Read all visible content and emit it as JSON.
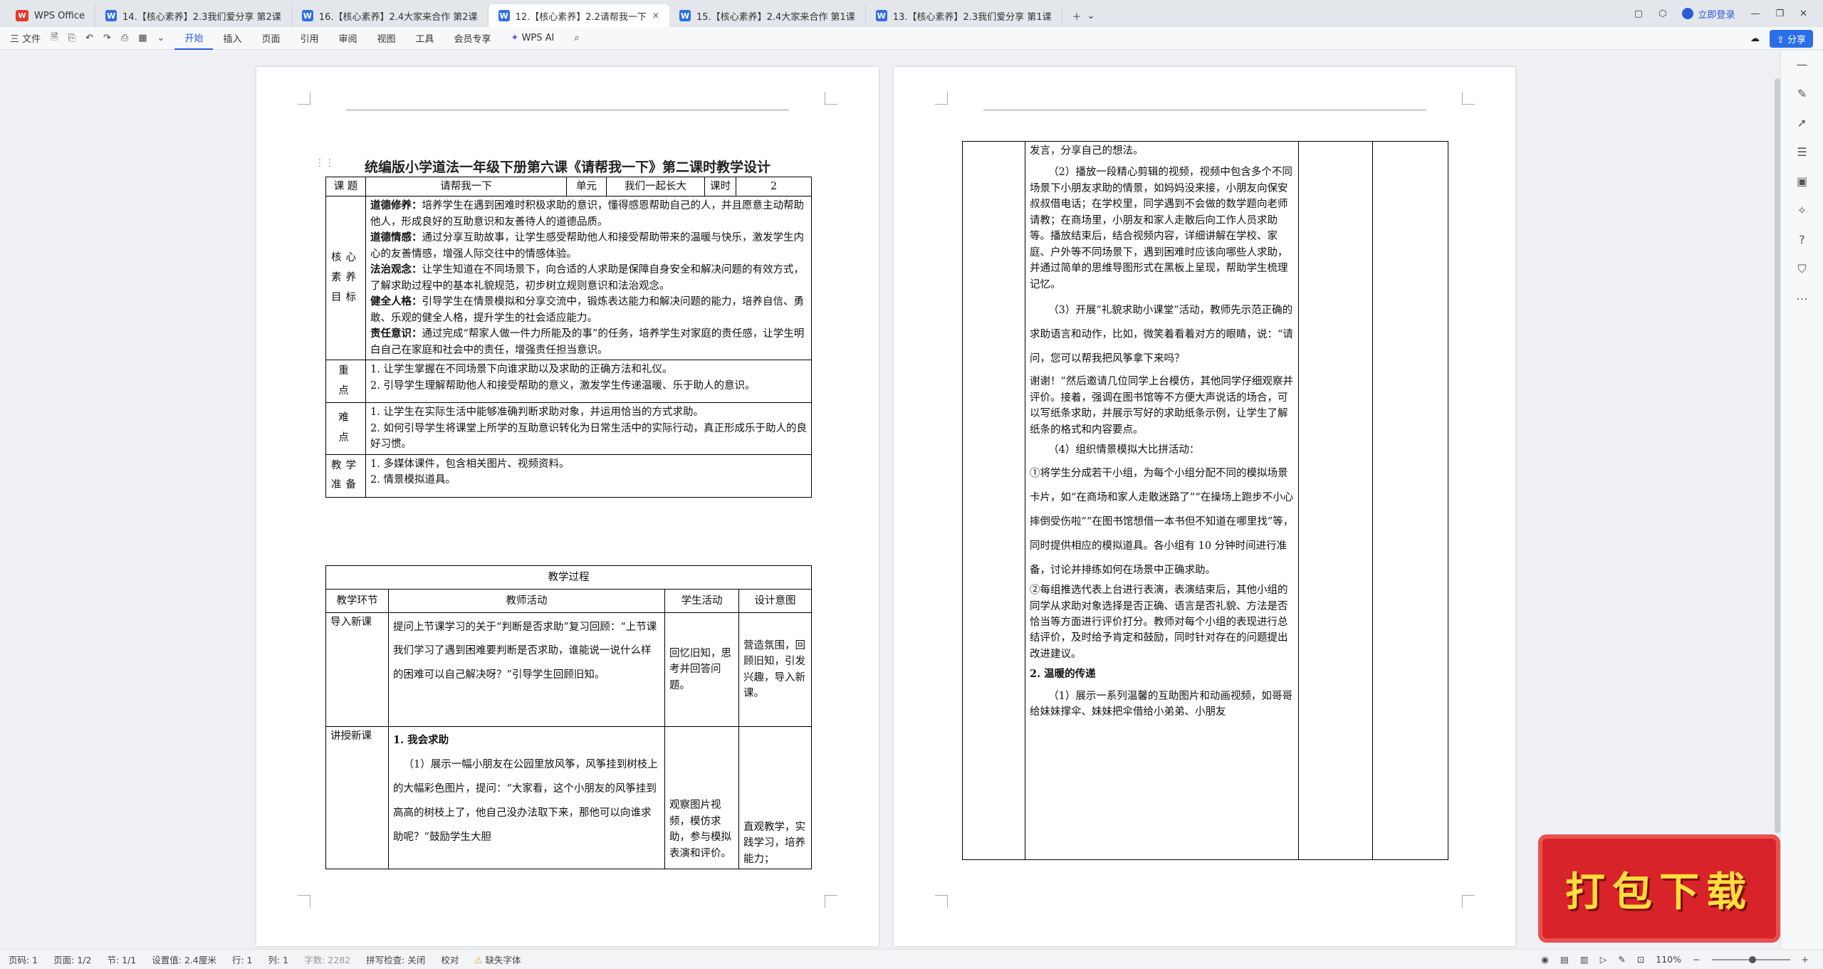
{
  "tabs": [
    {
      "label": "WPS Office",
      "icon": "wps-logo-icon"
    },
    {
      "label": "14.【核心素养】2.3我们爱分享 第2课",
      "icon": "word-doc-icon"
    },
    {
      "label": "16.【核心素养】2.4大家来合作 第2课",
      "icon": "word-doc-icon"
    },
    {
      "label": "12.【核心素养】2.2请帮我一下",
      "icon": "word-doc-icon",
      "active": true
    },
    {
      "label": "15.【核心素养】2.4大家来合作 第1课",
      "icon": "word-doc-icon"
    },
    {
      "label": "13.【核心素养】2.3我们爱分享 第1课",
      "icon": "word-doc-icon"
    }
  ],
  "login_label": "立即登录",
  "toolbar": {
    "file_label": "三 文件",
    "menus": [
      "开始",
      "插入",
      "页面",
      "引用",
      "审阅",
      "视图",
      "工具",
      "会员专享"
    ],
    "ai_label": "WPS AI",
    "share_label": "分享"
  },
  "doc": {
    "title": "统编版小学道法一年级下册第六课《请帮我一下》第二课时教学设计",
    "info": {
      "k_topic": "课 题",
      "v_topic": "请帮我一下",
      "k_unit": "单元",
      "v_unit": "我们一起长大",
      "k_period": "课时",
      "v_period": "2"
    },
    "core_label": "核心素养目标",
    "core": [
      {
        "lead": "道德修养：",
        "text": "培养学生在遇到困难时积极求助的意识，懂得感恩帮助自己的人，并且愿意主动帮助他人，形成良好的互助意识和友善待人的道德品质。"
      },
      {
        "lead": "道德情感：",
        "text": "通过分享互助故事，让学生感受帮助他人和接受帮助带来的温暖与快乐，激发学生内心的友善情感，增强人际交往中的情感体验。"
      },
      {
        "lead": "法治观念：",
        "text": "让学生知道在不同场景下，向合适的人求助是保障自身安全和解决问题的有效方式，了解求助过程中的基本礼貌规范，初步树立规则意识和法治观念。"
      },
      {
        "lead": "健全人格：",
        "text": "引导学生在情景模拟和分享交流中，锻炼表达能力和解决问题的能力，培养自信、勇敢、乐观的健全人格，提升学生的社会适应能力。"
      },
      {
        "lead": "责任意识：",
        "text": "通过完成“帮家人做一件力所能及的事”的任务，培养学生对家庭的责任感，让学生明白自己在家庭和社会中的责任，增强责任担当意识。"
      }
    ],
    "key_label": "重 点",
    "key_points": [
      "1. 让学生掌握在不同场景下向谁求助以及求助的正确方法和礼仪。",
      "2. 引导学生理解帮助他人和接受帮助的意义，激发学生传递温暖、乐于助人的意识。"
    ],
    "diff_label": "难 点",
    "diff_points": [
      "1. 让学生在实际生活中能够准确判断求助对象，并运用恰当的方式求助。",
      "2. 如何引导学生将课堂上所学的互助意识转化为日常生活中的实际行动，真正形成乐于助人的良好习惯。"
    ],
    "prep_label": "教学准备",
    "prep_points": [
      "1. 多媒体课件，包含相关图片、视频资料。",
      "2. 情景模拟道具。"
    ],
    "process_title": "教学过程",
    "process_headers": [
      "教学环节",
      "教师活动",
      "学生活动",
      "设计意图"
    ],
    "rows": [
      {
        "stage": "导入新课",
        "teacher": "提问上节课学习的关于“判断是否求助”复习回顾：“上节课我们学习了遇到困难要判断是否求助，谁能说一说什么样的困难可以自己解决呀？”引导学生回顾旧知。",
        "student": "回忆旧知，思考并回答问题。",
        "intent": "营造氛围，回顾旧知，引发兴趣，导入新课。"
      },
      {
        "stage": "讲授新课",
        "teacher_head": "1. 我会求助",
        "teacher": "（1）展示一幅小朋友在公园里放风筝，风筝挂到树枝上的大幅彩色图片，提问：“大家看，这个小朋友的风筝挂到高高的树枝上了，他自己没办法取下来，那他可以向谁求助呢？”鼓励学生大胆",
        "student": "观察图片视频，模仿求助，参与模拟表演和评价。",
        "intent": "直观教学，实践学习，培养能力；"
      }
    ],
    "page2": {
      "cont": "发言，分享自己的想法。",
      "p2": "（2）播放一段精心剪辑的视频，视频中包含多个不同场景下小朋友求助的情景，如妈妈没来接，小朋友向保安叔叔借电话；在学校里，同学遇到不会做的数学题向老师请教；在商场里，小朋友和家人走散后向工作人员求助等。播放结束后，结合视频内容，详细讲解在学校、家庭、户外等不同场景下，遇到困难时应该向哪些人求助，并通过简单的思维导图形式在黑板上呈现，帮助学生梳理记忆。",
      "p3": "（3）开展“礼貌求助小课堂”活动，教师先示范正确的求助语言和动作，比如，微笑着看着对方的眼睛，说：“请问，您可以帮我把风筝拿下来吗？",
      "p3b": "谢谢！”然后邀请几位同学上台模仿，其他同学仔细观察并评价。接着，强调在图书馆等不方便大声说话的场合，可以写纸条求助，并展示写好的求助纸条示例，让学生了解纸条的格式和内容要点。",
      "p4": "（4）组织情景模拟大比拼活动：",
      "p4a": "①将学生分成若干小组，为每个小组分配不同的模拟场景卡片，如“在商场和家人走散迷路了”“在操场上跑步不小心摔倒受伤啦”“在图书馆想借一本书但不知道在哪里找”等，同时提供相应的模拟道具。各小组有 10 分钟时间进行准备，讨论并排练如何在场景中正确求助。",
      "p4b": "②每组推选代表上台进行表演，表演结束后，其他小组的同学从求助对象选择是否正确、语言是否礼貌、方法是否恰当等方面进行评价打分。教师对每个小组的表现进行总结评价，及时给予肯定和鼓励，同时针对存在的问题提出改进建议。",
      "h2": "2. 温暖的传递",
      "p5": "（1）展示一系列温馨的互助图片和动画视频，如哥哥给妹妹撑伞、妹妹把伞借给小弟弟、小朋友"
    }
  },
  "status": {
    "page": "页码: 1",
    "pages": "页面: 1/2",
    "section": "节: 1/1",
    "setting": "设置值: 2.4厘米",
    "line": "行: 1",
    "col": "列: 1",
    "words": "字数: 2282",
    "spell": "拼写检查: 关闭",
    "proof": "校对",
    "font_missing": "缺失字体",
    "zoom": "110%"
  },
  "banner_text": "打包下载"
}
